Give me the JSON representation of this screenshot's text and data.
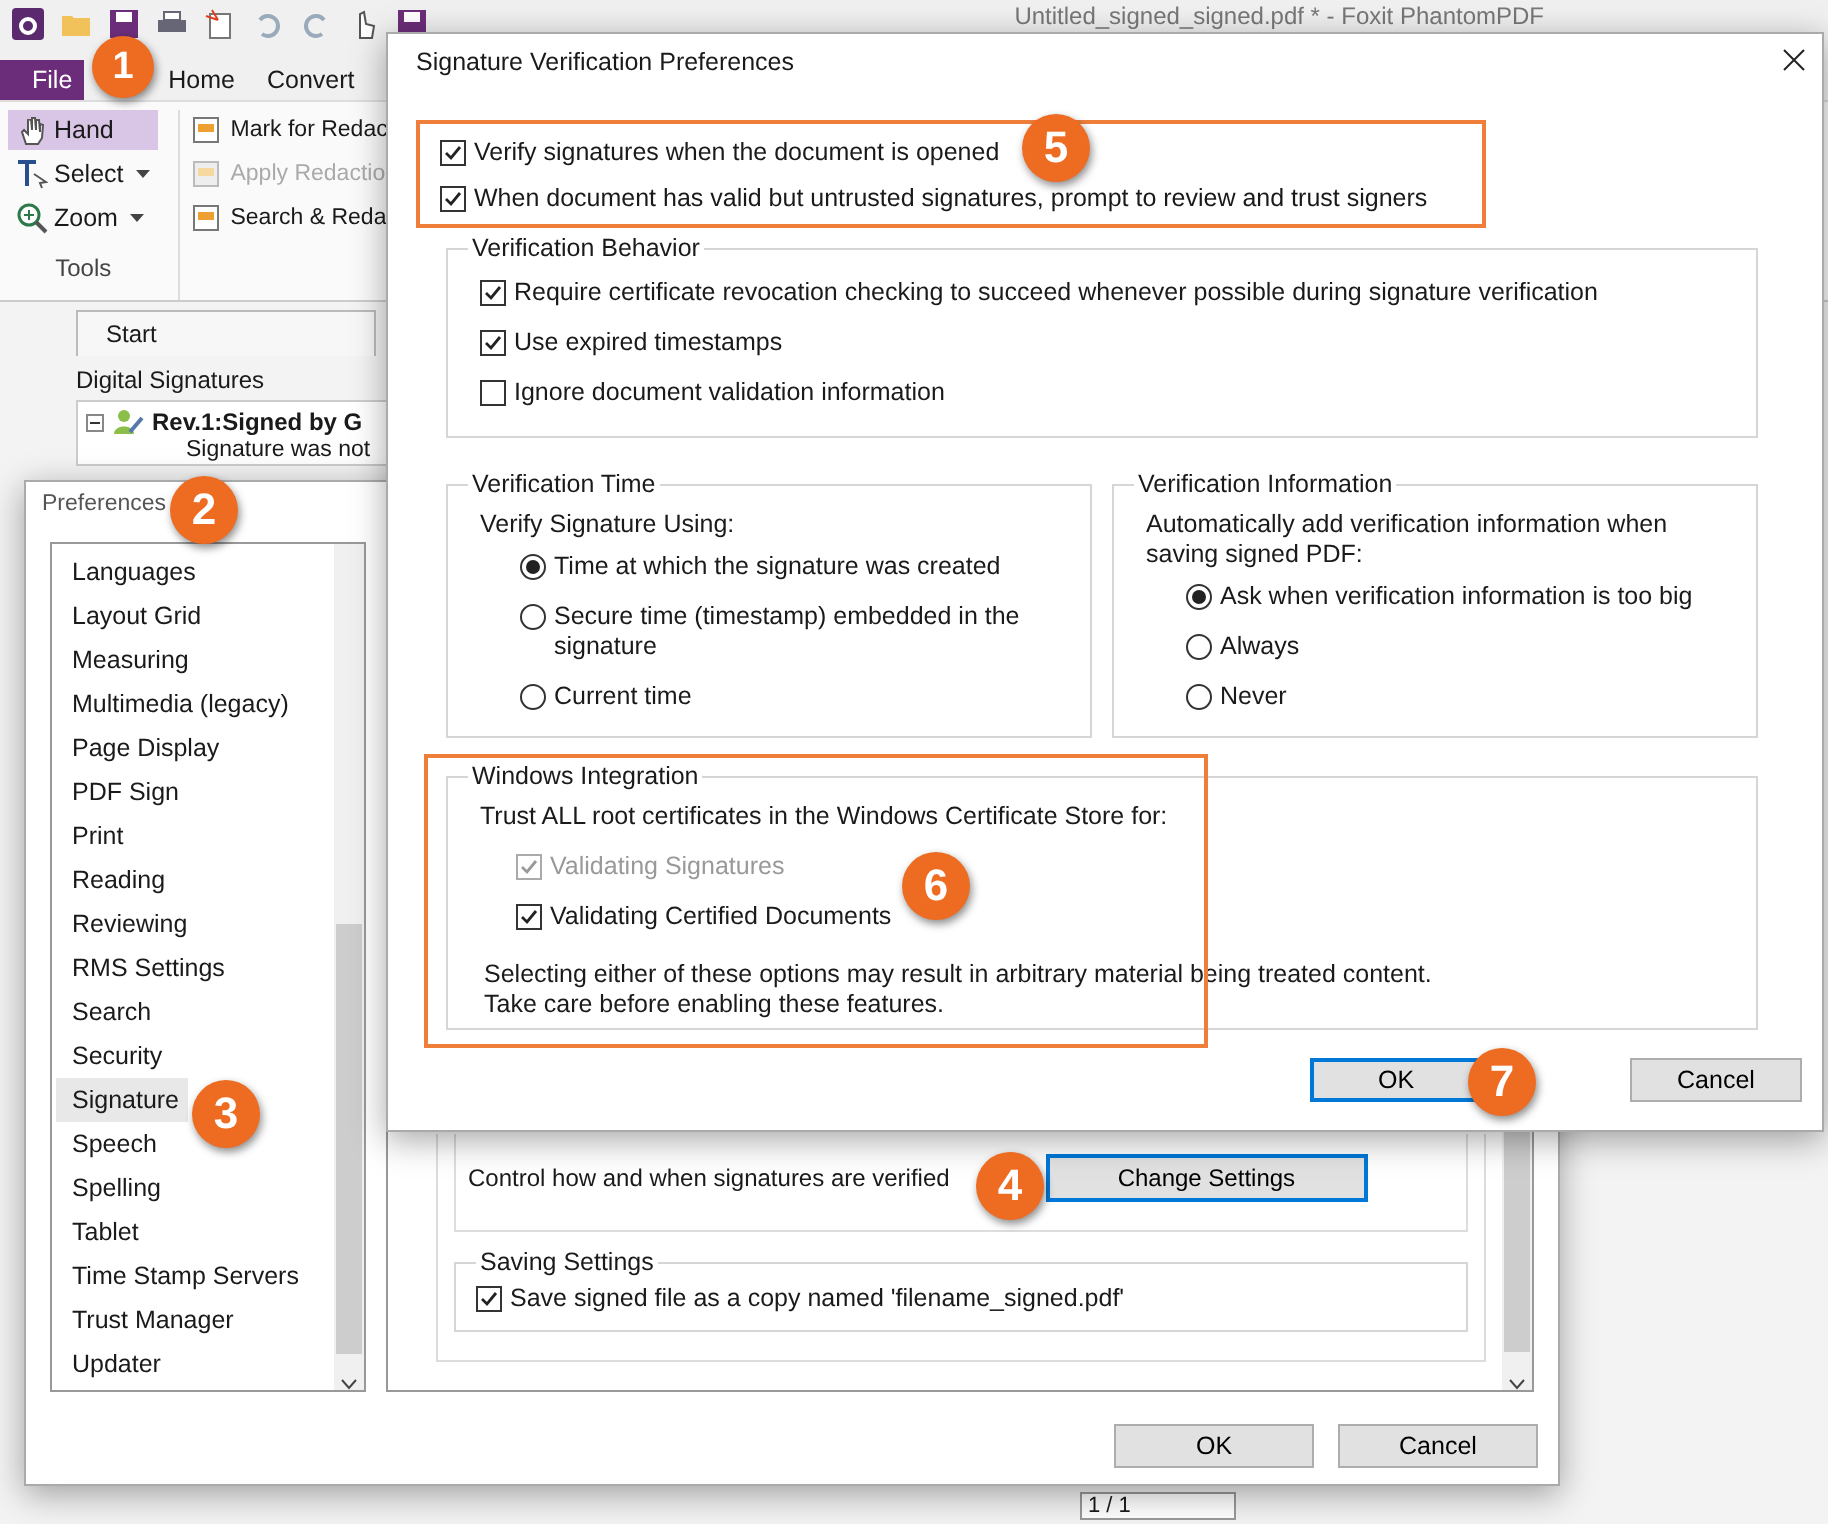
{
  "app": {
    "title": "Untitled_signed_signed.pdf * - Foxit PhantomPDF",
    "menu_tabs": [
      {
        "label": "File",
        "kind": "file"
      },
      {
        "label": "Home",
        "kind": "tab"
      },
      {
        "label": "Convert",
        "kind": "tab"
      }
    ],
    "tools": [
      {
        "label": "Hand",
        "selected": true,
        "dropdown": false,
        "kind": "hand"
      },
      {
        "label": "Select",
        "selected": false,
        "dropdown": true,
        "kind": "select"
      },
      {
        "label": "Zoom",
        "selected": false,
        "dropdown": true,
        "kind": "zoom"
      }
    ],
    "tools_group": "Tools",
    "redaction": [
      {
        "label": "Mark for Redac",
        "disabled": false
      },
      {
        "label": "Apply Redactio",
        "disabled": true
      },
      {
        "label": "Search & Reda",
        "disabled": false
      }
    ],
    "doc_tab": "Start",
    "panel_title": "Digital Signatures",
    "signature_item": {
      "title": "Rev.1:Signed by G",
      "status": "Signature was not",
      "expanded": true
    },
    "page_field": "1 / 1"
  },
  "preferences": {
    "title": "Preferences",
    "categories": [
      {
        "label": "Languages",
        "selected": false
      },
      {
        "label": "Layout Grid",
        "selected": false
      },
      {
        "label": "Measuring",
        "selected": false
      },
      {
        "label": "Multimedia (legacy)",
        "selected": false
      },
      {
        "label": "Page Display",
        "selected": false
      },
      {
        "label": "PDF Sign",
        "selected": false
      },
      {
        "label": "Print",
        "selected": false
      },
      {
        "label": "Reading",
        "selected": false
      },
      {
        "label": "Reviewing",
        "selected": false
      },
      {
        "label": "RMS Settings",
        "selected": false
      },
      {
        "label": "Search",
        "selected": false
      },
      {
        "label": "Security",
        "selected": false
      },
      {
        "label": "Signature",
        "selected": true
      },
      {
        "label": "Speech",
        "selected": false
      },
      {
        "label": "Spelling",
        "selected": false
      },
      {
        "label": "Tablet",
        "selected": false
      },
      {
        "label": "Time Stamp Servers",
        "selected": false
      },
      {
        "label": "Trust Manager",
        "selected": false
      },
      {
        "label": "Updater",
        "selected": false
      }
    ],
    "verify_text": "Control how and when signatures are verified",
    "change_button": "Change Settings",
    "saving_group": {
      "title": "Saving Settings",
      "options": [
        {
          "label": "Save signed file as a copy named 'filename_signed.pdf'",
          "checked": true,
          "disabled": false
        }
      ]
    },
    "buttons": [
      "OK",
      "Cancel"
    ]
  },
  "verification_dialog": {
    "title": "Signature Verification Preferences",
    "top_options": [
      {
        "label": "Verify signatures when the document is opened",
        "checked": true,
        "disabled": false
      },
      {
        "label": "When document has valid but untrusted signatures, prompt to review and trust signers",
        "checked": true,
        "disabled": false
      }
    ],
    "behavior": {
      "title": "Verification Behavior",
      "options": [
        {
          "label": "Require certificate revocation checking to succeed whenever possible during signature verification",
          "checked": true,
          "disabled": false
        },
        {
          "label": "Use expired timestamps",
          "checked": true,
          "disabled": false
        },
        {
          "label": "Ignore document validation information",
          "checked": false,
          "disabled": false
        }
      ]
    },
    "time": {
      "title": "Verification Time",
      "prompt": "Verify Signature Using:",
      "options": [
        {
          "label": "Time at which the signature was created",
          "selected": true
        },
        {
          "label": "Secure time (timestamp) embedded in the signature",
          "selected": false
        },
        {
          "label": "Current time",
          "selected": false
        }
      ]
    },
    "information": {
      "title": "Verification Information",
      "prompt": "Automatically add verification information when saving signed PDF:",
      "options": [
        {
          "label": "Ask when verification information is too big",
          "selected": true
        },
        {
          "label": "Always",
          "selected": false
        },
        {
          "label": "Never",
          "selected": false
        }
      ]
    },
    "windows": {
      "title": "Windows Integration",
      "prompt": "Trust ALL root certificates in the Windows Certificate Store for:",
      "options": [
        {
          "label": "Validating Signatures",
          "checked": true,
          "disabled": true
        },
        {
          "label": "Validating Certified Documents",
          "checked": true,
          "disabled": false
        }
      ],
      "note": "Selecting either of these options may result in arbitrary material being treated content.\nTake care before enabling these features."
    },
    "buttons": [
      {
        "label": "OK",
        "default": true
      },
      {
        "label": "Cancel",
        "default": false
      }
    ]
  },
  "callouts": [
    "1",
    "2",
    "3",
    "4",
    "5",
    "6",
    "7"
  ]
}
